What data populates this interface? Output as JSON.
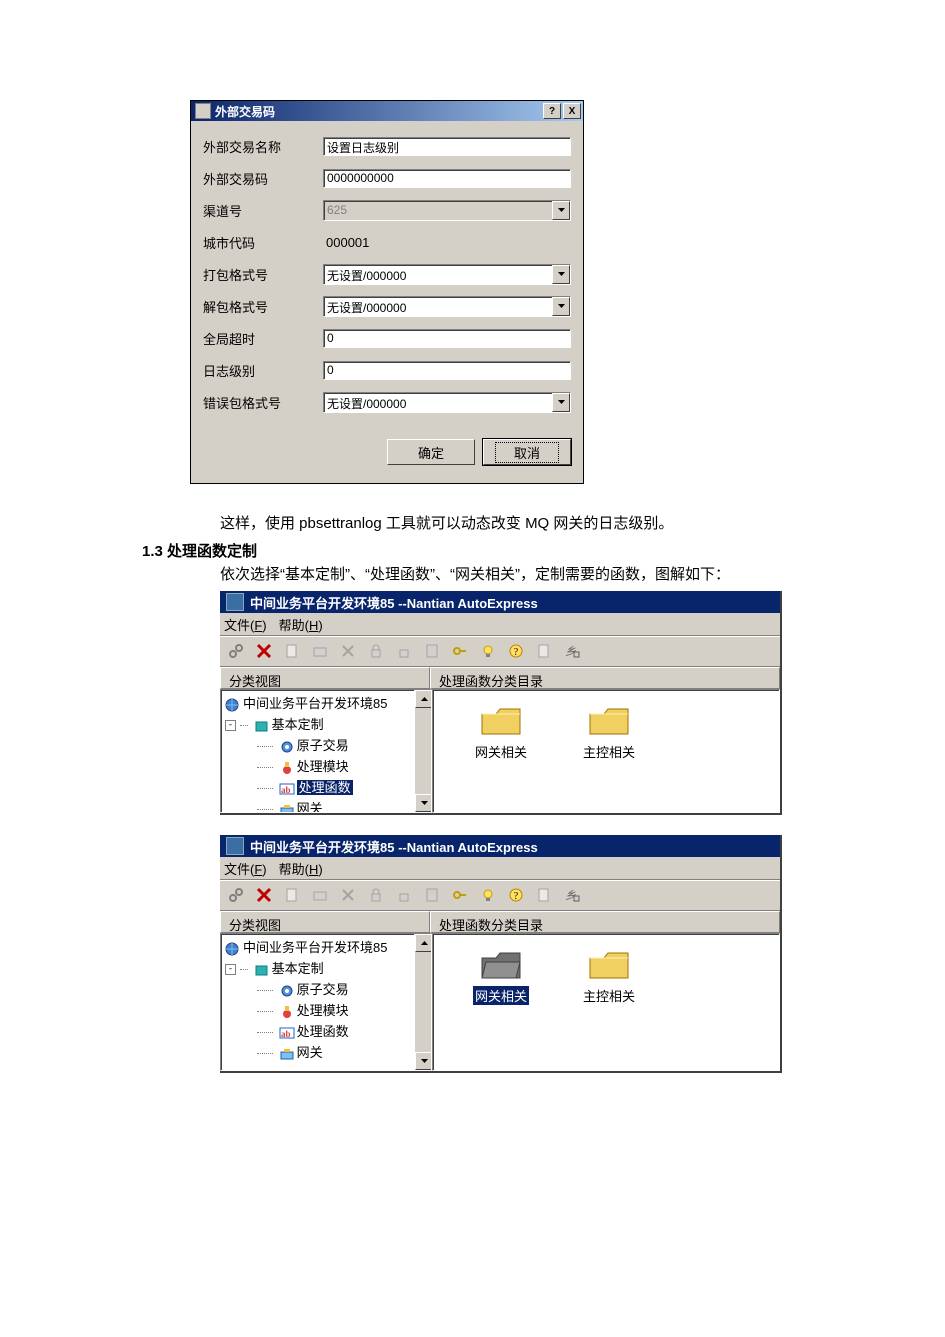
{
  "dialog": {
    "title": "外部交易码",
    "help_btn": "?",
    "close_btn": "X",
    "fields": {
      "name_label": "外部交易名称",
      "name_value": "设置日志级别",
      "code_label": "外部交易码",
      "code_value": "0000000000",
      "channel_label": "渠道号",
      "channel_value": "625",
      "city_label": "城市代码",
      "city_value": "000001",
      "pack_label": "打包格式号",
      "pack_value": "无设置/000000",
      "unpack_label": "解包格式号",
      "unpack_value": "无设置/000000",
      "timeout_label": "全局超时",
      "timeout_value": "0",
      "loglevel_label": "日志级别",
      "loglevel_value": "0",
      "errpack_label": "错误包格式号",
      "errpack_value": "无设置/000000"
    },
    "buttons": {
      "ok": "确定",
      "cancel": "取消"
    }
  },
  "text": {
    "p1": "这样，使用 pbsettranlog 工具就可以动态改变 MQ 网关的日志级别。",
    "heading": "1.3 处理函数定制",
    "p2": "依次选择“基本定制”、“处理函数”、“网关相关”，定制需要的函数，图解如下："
  },
  "ide": {
    "title": "中间业务平台开发环境85 --Nantian AutoExpress",
    "menu_file": "文件(F)",
    "menu_help": "帮助(H)",
    "panel_left_header": "分类视图",
    "panel_right_header": "处理函数分类目录",
    "tree": {
      "root": "中间业务平台开发环境85",
      "n1": "基本定制",
      "n1_1": "原子交易",
      "n1_2": "处理模块",
      "n1_3": "处理函数",
      "n1_4": "网关"
    },
    "folders": {
      "f1": "网关相关",
      "f2": "主控相关"
    }
  }
}
